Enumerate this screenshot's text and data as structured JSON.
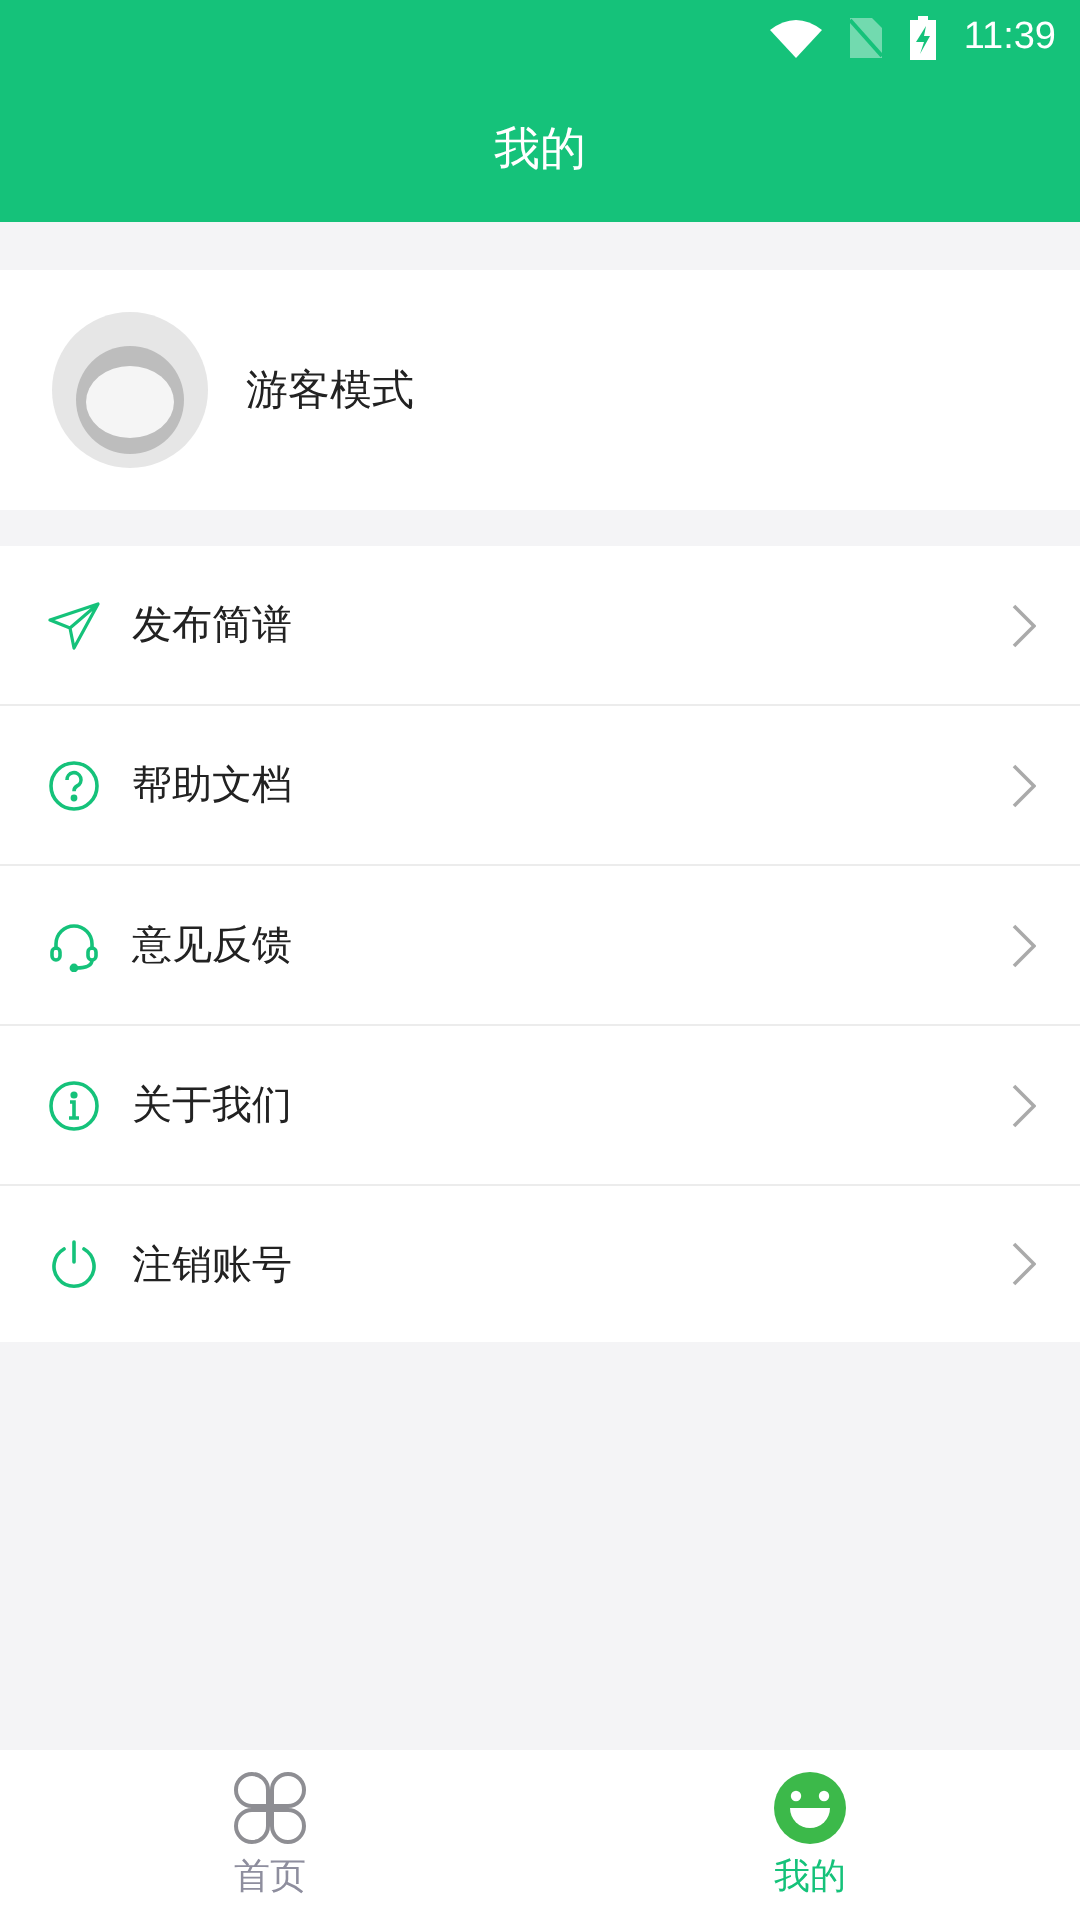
{
  "status_bar": {
    "time": "11:39"
  },
  "header": {
    "title": "我的"
  },
  "profile": {
    "name": "游客模式"
  },
  "menu": [
    {
      "kind": "send",
      "label": "发布简谱"
    },
    {
      "kind": "help",
      "label": "帮助文档"
    },
    {
      "kind": "headset",
      "label": "意见反馈"
    },
    {
      "kind": "info",
      "label": "关于我们"
    },
    {
      "kind": "power",
      "label": "注销账号"
    }
  ],
  "bottom_nav": [
    {
      "kind": "home",
      "label": "首页",
      "selected": false
    },
    {
      "kind": "me",
      "label": "我的",
      "selected": true
    }
  ]
}
